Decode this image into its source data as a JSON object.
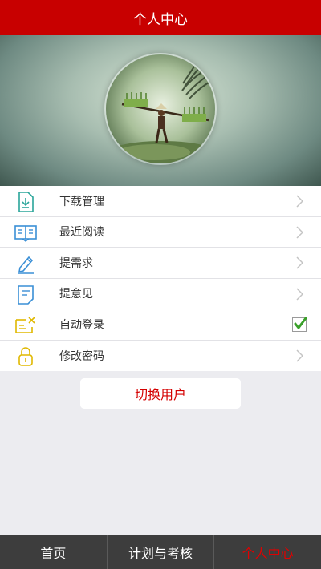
{
  "header": {
    "title": "个人中心"
  },
  "menu": {
    "items": [
      {
        "label": "下载管理",
        "icon": "download-file-icon",
        "right": "chevron"
      },
      {
        "label": "最近阅读",
        "icon": "open-book-icon",
        "right": "chevron"
      },
      {
        "label": "提需求",
        "icon": "pen-icon",
        "right": "chevron"
      },
      {
        "label": "提意见",
        "icon": "note-icon",
        "right": "chevron"
      },
      {
        "label": "自动登录",
        "icon": "auto-login-icon",
        "right": "check",
        "checked": true
      },
      {
        "label": "修改密码",
        "icon": "lock-icon",
        "right": "chevron"
      }
    ]
  },
  "actions": {
    "switch_user": "切换用户"
  },
  "tabbar": {
    "tabs": [
      {
        "label": "首页",
        "active": false
      },
      {
        "label": "计划与考核",
        "active": false
      },
      {
        "label": "个人中心",
        "active": true
      }
    ]
  },
  "colors": {
    "header_bg": "#c80000",
    "accent_red": "#d40000",
    "tabbar_bg": "#3d3d3d",
    "icon_teal": "#2aa59a",
    "icon_blue": "#3a8fd6",
    "icon_yellow": "#e0b800",
    "check_green": "#3aa02a"
  }
}
